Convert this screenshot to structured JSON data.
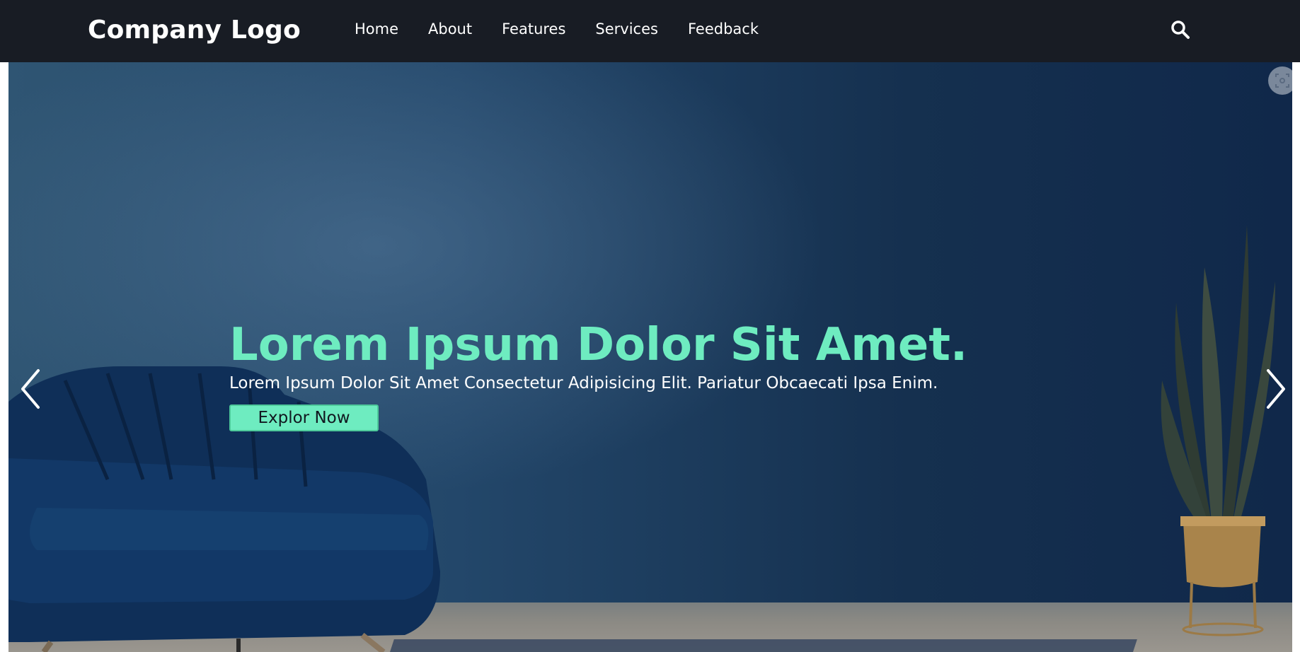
{
  "navbar": {
    "logo": "Company Logo",
    "links": [
      "Home",
      "About",
      "Features",
      "Services",
      "Feedback"
    ],
    "search_icon": "search-icon"
  },
  "hero": {
    "title": "Lorem Ipsum Dolor Sit Amet.",
    "subtitle": "Lorem Ipsum Dolor Sit Amet Consectetur Adipisicing Elit. Pariatur Obcaecati Ipsa Enim.",
    "cta_label": "Explor Now",
    "prev_icon": "chevron-left-icon",
    "next_icon": "chevron-right-icon",
    "screenshot_icon": "screenshot-icon"
  },
  "colors": {
    "nav_bg": "#181c24",
    "accent": "#6eecc0",
    "text": "#ffffff"
  }
}
